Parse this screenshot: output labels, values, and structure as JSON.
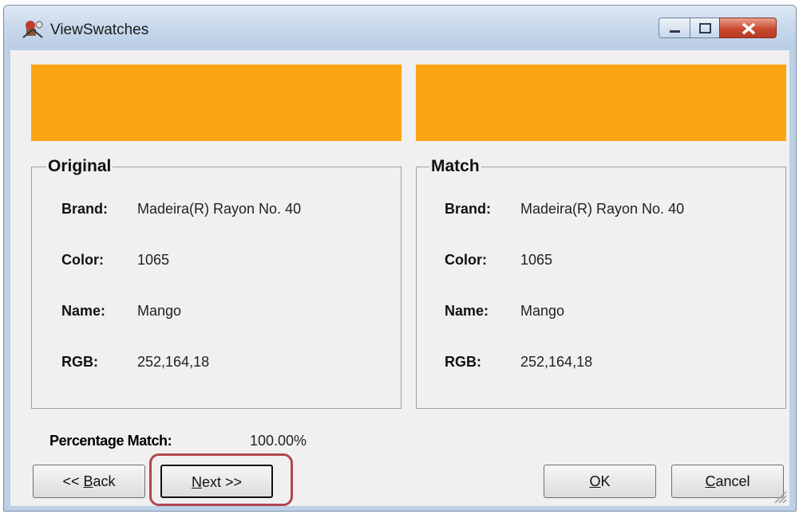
{
  "window": {
    "title": "ViewSwatches"
  },
  "swatch_color": "#fca412",
  "original": {
    "heading": "Original",
    "brand_label": "Brand:",
    "brand": "Madeira(R) Rayon No. 40",
    "color_label": "Color:",
    "color": "1065",
    "name_label": "Name:",
    "name": "Mango",
    "rgb_label": "RGB:",
    "rgb": "252,164,18"
  },
  "match": {
    "heading": "Match",
    "brand_label": "Brand:",
    "brand": "Madeira(R) Rayon No. 40",
    "color_label": "Color:",
    "color": "1065",
    "name_label": "Name:",
    "name": "Mango",
    "rgb_label": "RGB:",
    "rgb": "252,164,18"
  },
  "percentage": {
    "label": "Percentage Match:",
    "value": "100.00%"
  },
  "buttons": {
    "back_prefix": "<< ",
    "back_key": "B",
    "back_rest": "ack",
    "next_key": "N",
    "next_rest": "ext >>",
    "ok_key": "O",
    "ok_rest": "K",
    "cancel_key": "C",
    "cancel_rest": "ancel"
  },
  "icons": {
    "app": "thread-spool-icon",
    "minimize": "minimize-icon",
    "maximize": "maximize-icon",
    "close": "close-icon",
    "grip": "resize-grip-icon"
  },
  "colors": {
    "highlight": "#b2464d",
    "close_button": "#c94a30"
  }
}
